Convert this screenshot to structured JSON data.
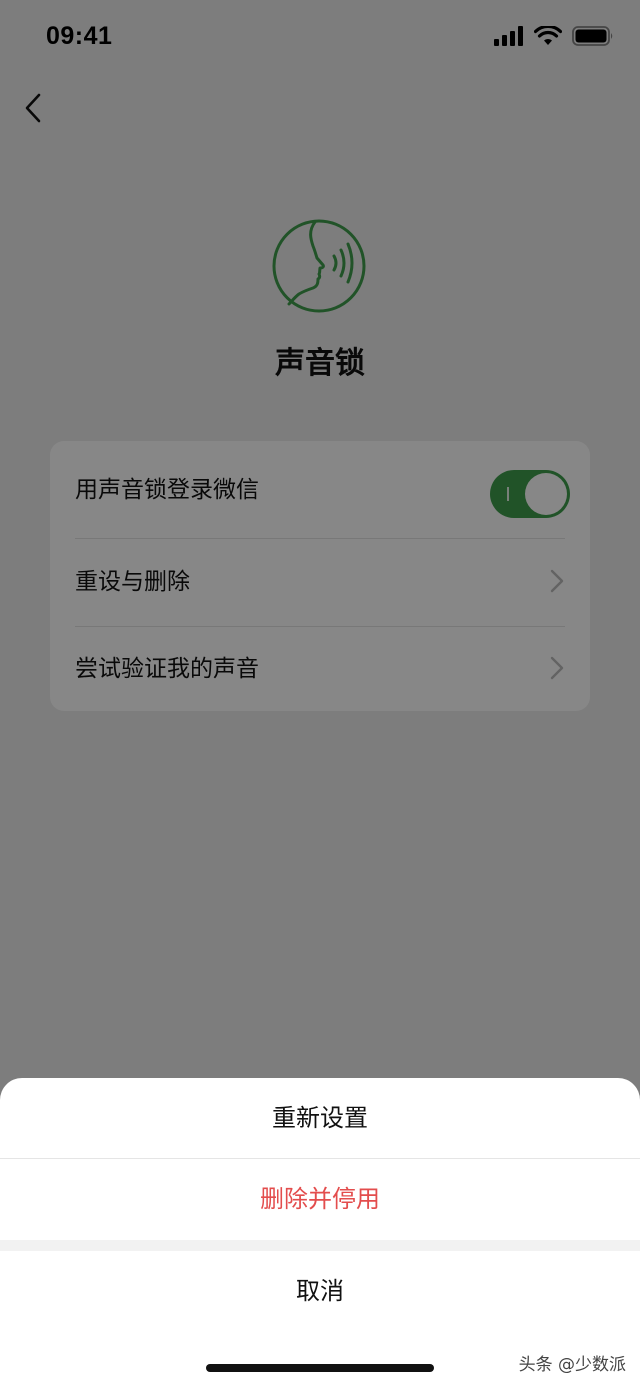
{
  "status_bar": {
    "time": "09:41",
    "icons": [
      "signal-icon",
      "wifi-icon",
      "battery-icon"
    ]
  },
  "nav": {
    "back_icon": "chevron-left-icon"
  },
  "header": {
    "logo_icon": "voice-face-icon",
    "title": "声音锁"
  },
  "settings": {
    "items": [
      {
        "label": "用声音锁登录微信",
        "control": "toggle",
        "toggle_on": true
      },
      {
        "label": "重设与删除",
        "control": "chevron"
      },
      {
        "label": "尝试验证我的声音",
        "control": "chevron"
      }
    ]
  },
  "action_sheet": {
    "reset_label": "重新设置",
    "delete_label": "删除并停用",
    "cancel_label": "取消"
  },
  "watermark": "头条 @少数派",
  "colors": {
    "accent_green": "#3f9e4d",
    "destructive_red": "#e34d4d",
    "overlay": "rgba(0,0,0,0.47)"
  }
}
